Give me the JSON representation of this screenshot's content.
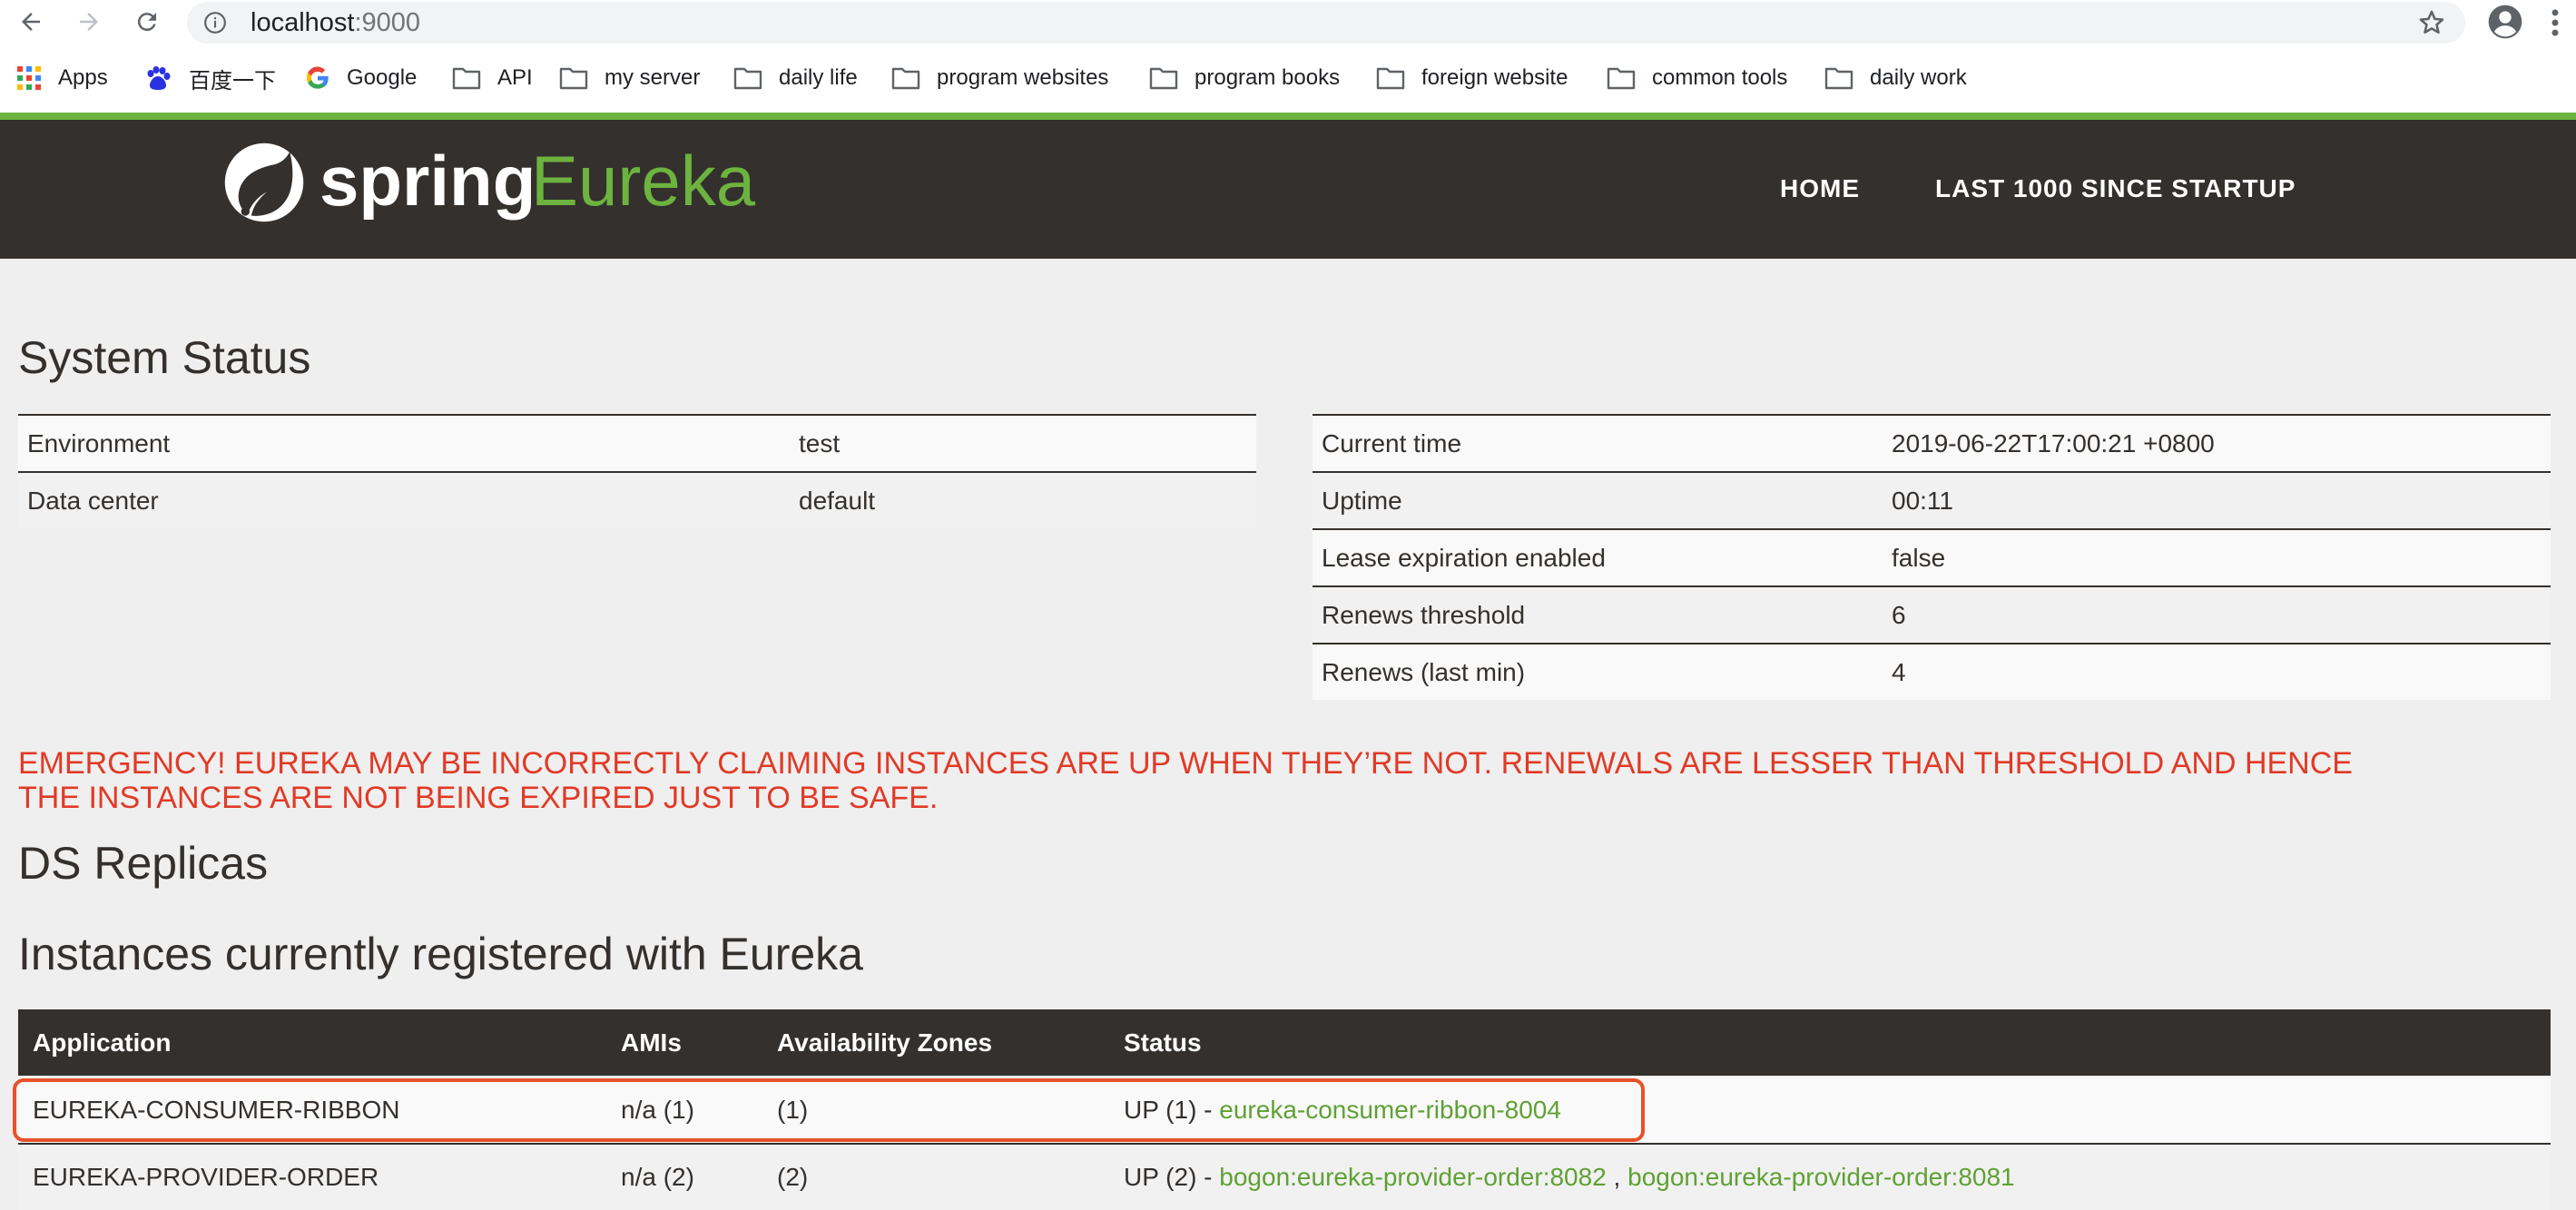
{
  "browser": {
    "url_host": "localhost",
    "url_port": ":9000",
    "bookmarks": [
      {
        "label": "Apps",
        "icon": "apps-grid-icon"
      },
      {
        "label": "百度一下",
        "icon": "baidu-paw-icon"
      },
      {
        "label": "Google",
        "icon": "google-g-icon"
      },
      {
        "label": "API",
        "icon": "folder-icon"
      },
      {
        "label": "my server",
        "icon": "folder-icon"
      },
      {
        "label": "daily life",
        "icon": "folder-icon"
      },
      {
        "label": "program websites",
        "icon": "folder-icon"
      },
      {
        "label": "program books",
        "icon": "folder-icon"
      },
      {
        "label": "foreign website",
        "icon": "folder-icon"
      },
      {
        "label": "common tools",
        "icon": "folder-icon"
      },
      {
        "label": "daily work",
        "icon": "folder-icon"
      }
    ]
  },
  "header": {
    "logo_spring": "spring",
    "logo_eureka": "Eureka",
    "nav": [
      "HOME",
      "LAST 1000 SINCE STARTUP"
    ]
  },
  "system_status": {
    "title": "System Status",
    "left": [
      {
        "key": "Environment",
        "value": "test"
      },
      {
        "key": "Data center",
        "value": "default"
      }
    ],
    "right": [
      {
        "key": "Current time",
        "value": "2019-06-22T17:00:21 +0800"
      },
      {
        "key": "Uptime",
        "value": "00:11"
      },
      {
        "key": "Lease expiration enabled",
        "value": "false"
      },
      {
        "key": "Renews threshold",
        "value": "6"
      },
      {
        "key": "Renews (last min)",
        "value": "4"
      }
    ]
  },
  "emergency": {
    "line1": "EMERGENCY! EUREKA MAY BE INCORRECTLY CLAIMING INSTANCES ARE UP WHEN THEY’RE NOT. RENEWALS ARE LESSER THAN THRESHOLD AND HENCE",
    "line2": "THE INSTANCES ARE NOT BEING EXPIRED JUST TO BE SAFE."
  },
  "ds_replicas": {
    "title": "DS Replicas"
  },
  "instances": {
    "title": "Instances currently registered with Eureka",
    "columns": [
      "Application",
      "AMIs",
      "Availability Zones",
      "Status"
    ],
    "rows": [
      {
        "application": "EUREKA-CONSUMER-RIBBON",
        "amis": "n/a (1)",
        "zones": "(1)",
        "status_prefix": "UP (1) - ",
        "links": [
          "eureka-consumer-ribbon-8004"
        ],
        "separator": ""
      },
      {
        "application": "EUREKA-PROVIDER-ORDER",
        "amis": "n/a (2)",
        "zones": "(2)",
        "status_prefix": "UP (2) - ",
        "links": [
          "bogon:eureka-provider-order:8082",
          "bogon:eureka-provider-order:8081"
        ],
        "separator": " , "
      }
    ]
  },
  "colors": {
    "accent_green": "#6db33f",
    "nav_bg": "#34302d",
    "emergency_red": "#e13a26",
    "highlight_orange": "#e8512a"
  }
}
